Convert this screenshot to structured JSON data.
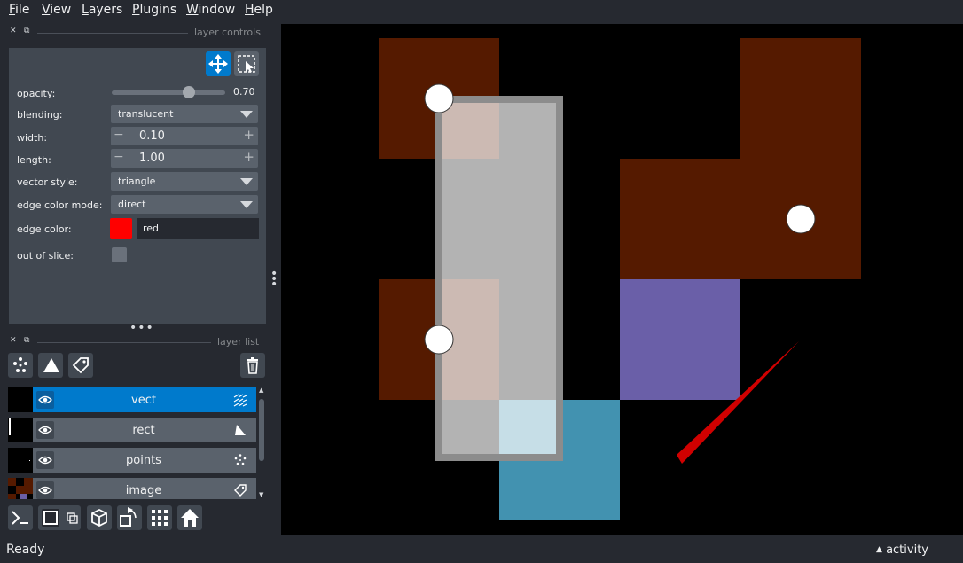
{
  "menu": {
    "file": {
      "u": "F",
      "rest": "ile"
    },
    "view": {
      "u": "V",
      "rest": "iew"
    },
    "layers": {
      "u": "L",
      "rest": "ayers"
    },
    "plugins": {
      "u": "P",
      "rest": "lugins"
    },
    "window": {
      "u": "W",
      "rest": "indow"
    },
    "help": {
      "u": "H",
      "rest": "elp"
    }
  },
  "layer_controls": {
    "title": "layer controls",
    "opacity": {
      "label": "opacity:",
      "value": "0.70",
      "fraction": 0.7
    },
    "blending": {
      "label": "blending:",
      "value": "translucent"
    },
    "width": {
      "label": "width:",
      "value": "0.10"
    },
    "length": {
      "label": "length:",
      "value": "1.00"
    },
    "vector_style": {
      "label": "vector style:",
      "value": "triangle"
    },
    "edge_color_mode": {
      "label": "edge color mode:",
      "value": "direct"
    },
    "edge_color": {
      "label": "edge color:",
      "value": "red",
      "swatch": "#ff0000"
    },
    "out_of_slice": {
      "label": "out of slice:",
      "checked": false
    }
  },
  "layer_list": {
    "title": "layer list",
    "layers": [
      {
        "name": "vect",
        "selected": true,
        "icon": "vectors-icon"
      },
      {
        "name": "rect",
        "selected": false,
        "icon": "shapes-icon"
      },
      {
        "name": "points",
        "selected": false,
        "icon": "points-icon"
      },
      {
        "name": "image",
        "selected": false,
        "icon": "labels-icon"
      }
    ]
  },
  "status": {
    "text": "Ready",
    "activity": "activity"
  },
  "colors": {
    "accent": "#007acc",
    "background": "#262930",
    "panel": "#414851",
    "control": "#5a626c"
  }
}
